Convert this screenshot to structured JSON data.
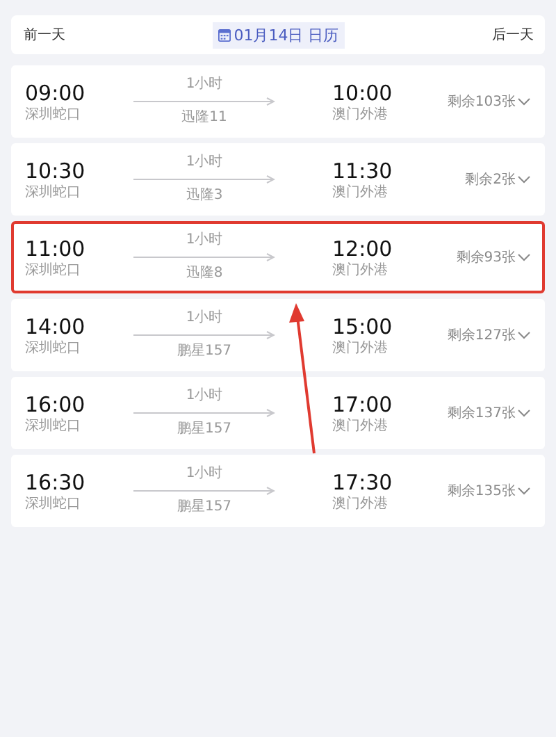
{
  "date_bar": {
    "prev": "前一天",
    "date": "01月14日",
    "calendar": "日历",
    "next": "后一天"
  },
  "trips": [
    {
      "depart_time": "09:00",
      "depart_port": "深圳蛇口",
      "duration": "1小时",
      "vessel": "迅隆11",
      "arrive_time": "10:00",
      "arrive_port": "澳门外港",
      "remaining": "剩余103张",
      "highlighted": false
    },
    {
      "depart_time": "10:30",
      "depart_port": "深圳蛇口",
      "duration": "1小时",
      "vessel": "迅隆3",
      "arrive_time": "11:30",
      "arrive_port": "澳门外港",
      "remaining": "剩余2张",
      "highlighted": false
    },
    {
      "depart_time": "11:00",
      "depart_port": "深圳蛇口",
      "duration": "1小时",
      "vessel": "迅隆8",
      "arrive_time": "12:00",
      "arrive_port": "澳门外港",
      "remaining": "剩余93张",
      "highlighted": true
    },
    {
      "depart_time": "14:00",
      "depart_port": "深圳蛇口",
      "duration": "1小时",
      "vessel": "鹏星157",
      "arrive_time": "15:00",
      "arrive_port": "澳门外港",
      "remaining": "剩余127张",
      "highlighted": false
    },
    {
      "depart_time": "16:00",
      "depart_port": "深圳蛇口",
      "duration": "1小时",
      "vessel": "鹏星157",
      "arrive_time": "17:00",
      "arrive_port": "澳门外港",
      "remaining": "剩余137张",
      "highlighted": false
    },
    {
      "depart_time": "16:30",
      "depart_port": "深圳蛇口",
      "duration": "1小时",
      "vessel": "鹏星157",
      "arrive_time": "17:30",
      "arrive_port": "澳门外港",
      "remaining": "剩余135张",
      "highlighted": false
    }
  ]
}
